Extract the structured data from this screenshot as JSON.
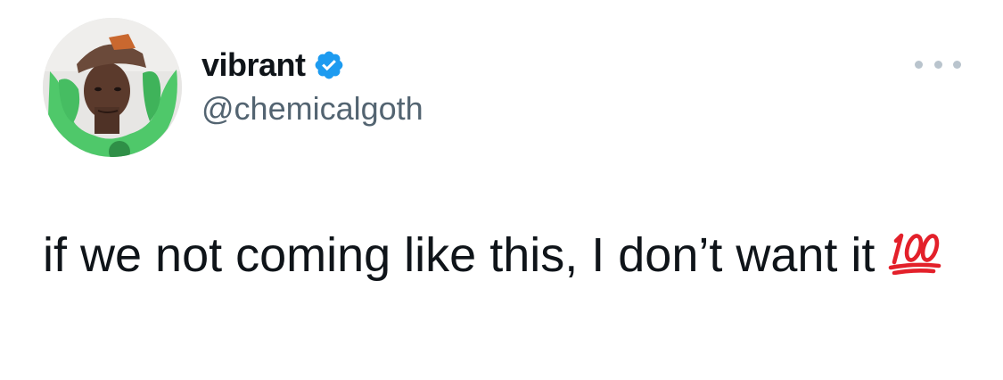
{
  "tweet": {
    "author": {
      "display_name": "vibrant",
      "handle": "@chemicalgoth",
      "verified": true,
      "verified_icon": "verified-badge-icon",
      "verified_color": "#1d9bf0"
    },
    "more_icon": "more-horizontal-icon",
    "text": "if we not coming like this, I don’t want it",
    "emoji": "hundred-points-icon",
    "emoji_color": "#e3202a"
  }
}
